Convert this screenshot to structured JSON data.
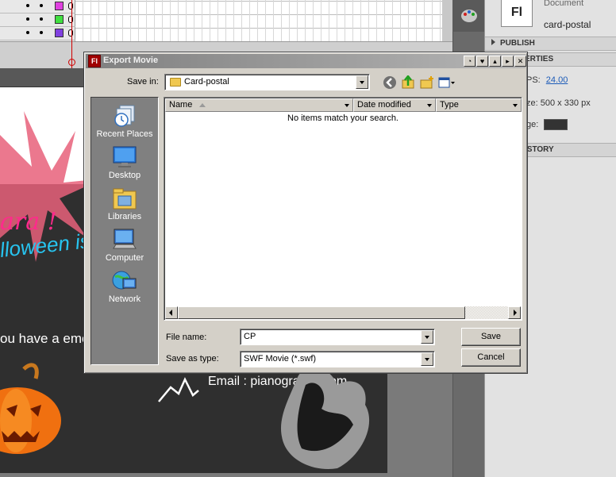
{
  "dialog": {
    "title": "Export Movie",
    "app_icon_text": "Fl",
    "save_in_label": "Save in:",
    "save_in_value": "Card-postal",
    "columns": [
      "Name",
      "Date modified",
      "Type"
    ],
    "empty_message": "No items match your search.",
    "places": [
      "Recent Places",
      "Desktop",
      "Libraries",
      "Computer",
      "Network"
    ],
    "file_name_label": "File name:",
    "file_name_value": "CP",
    "save_as_type_label": "Save as type:",
    "save_as_type_value": "SWF Movie (*.swf)",
    "save_button": "Save",
    "cancel_button": "Cancel",
    "nav_icons": [
      "back-icon",
      "up-folder-icon",
      "new-folder-icon",
      "view-menu-icon"
    ]
  },
  "properties_panel": {
    "doc_icon_text": "Fl",
    "doc_label": "Document",
    "doc_name": "card-postal",
    "publish_header": "PUBLISH",
    "properties_header": "ERTIES",
    "fps_prefix": "PS:",
    "fps_value": "24.00",
    "size_text": "ze:  500 x 330 px",
    "background_text": "ge:",
    "history_header": "ISTORY"
  },
  "stage": {
    "text_pink": "ara !",
    "text_blue": "lloween is in",
    "text_white": "ou have a emot",
    "email_text": "Email : pianogrand                    ilcom"
  },
  "timeline": {
    "layer_swatch_colors": [
      "#e040e0",
      "#40e040",
      "#8040e0"
    ]
  }
}
